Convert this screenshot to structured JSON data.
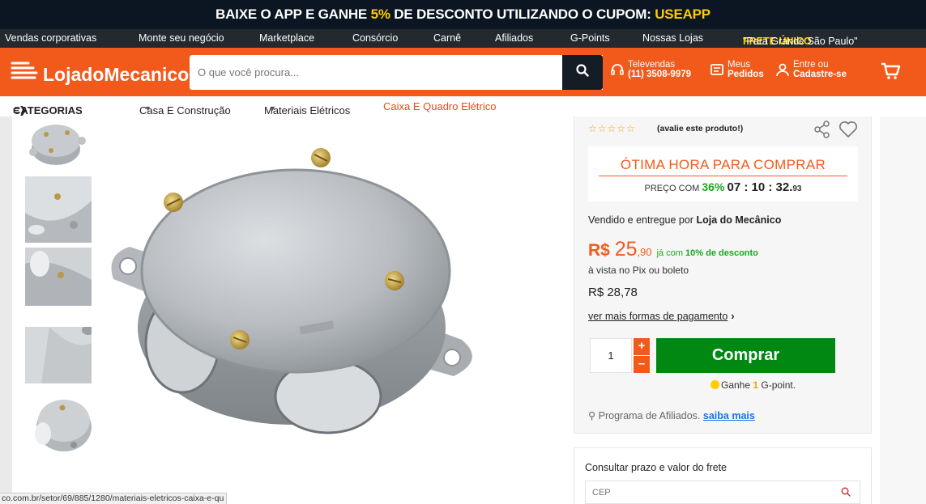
{
  "promo": {
    "part1": "BAIXE O APP E GANHE ",
    "pct": "5%",
    "part2": " DE DESCONTO UTILIZANDO O CUPOM: ",
    "coupon": "USEAPP"
  },
  "nav": {
    "items": [
      "Vendas corporativas",
      "Monte seu negócio",
      "Marketplace",
      "Consórcio",
      "Carnê",
      "Afiliados",
      "G-Points",
      "Nossas Lojas"
    ],
    "frete_bold": "FRETE ÚNICO",
    "frete_rest": " \"Para Grande São Paulo\""
  },
  "header": {
    "logo_text": "LojadoMecanico",
    "search_placeholder": "O que você procura...",
    "televendas_label": "Televendas",
    "televendas_phone": "(11) 3508-9979",
    "pedidos_line1": "Meus",
    "pedidos_line2": "Pedidos",
    "login_line1": "Entre ou",
    "login_line2": "Cadastre-se"
  },
  "categories": {
    "label": "CATEGORIAS",
    "crumbs": [
      "Casa E Construção",
      "Materiais Elétricos",
      "Caixa E Quadro Elétrico"
    ]
  },
  "product": {
    "rating_text": "(avalie este produto!)",
    "timer_title": "ÓTIMA HORA PARA COMPRAR",
    "timer_prefix": "PREÇO COM ",
    "timer_pct": "36%",
    "timer_clock": "07 : 10 : 32.",
    "timer_ms": "93",
    "seller_prefix": "Vendido e entregue por ",
    "seller_name": "Loja do Mecânico",
    "price_currency": "R$ ",
    "price_int": "25",
    "price_dec": ",90",
    "price_disc_prefix": "já com ",
    "price_disc_bold": "10% de desconto",
    "pix_text": "à vista no Pix ou boleto",
    "price_full": "R$ 28,78",
    "more_payment": "ver mais formas de pagamento",
    "quantity": "1",
    "buy_label": "Comprar",
    "gpoint_prefix": "Ganhe ",
    "gpoint_value": "1",
    "gpoint_suffix": " G-point.",
    "affil_text": "Programa de Afiliados. ",
    "affil_link": "saiba mais"
  },
  "frete": {
    "title": "Consultar prazo e valor do frete",
    "cep_placeholder": "CEP"
  },
  "status_url": "co.com.br/setor/69/885/1280/materiais-eletricos-caixa-e-qu",
  "colors": {
    "brand_orange": "#f25a1c",
    "promo_bg": "#0b1622",
    "buy_green": "#008812",
    "highlight_yellow": "#ffcc00"
  }
}
